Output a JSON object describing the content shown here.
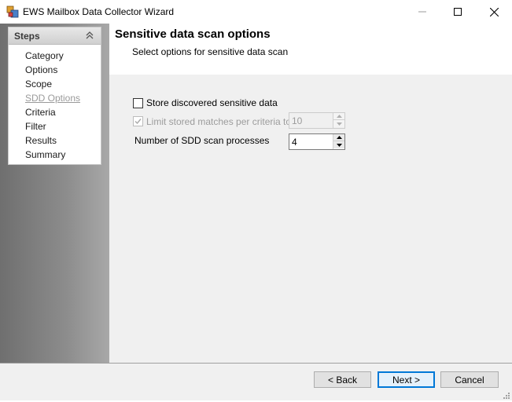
{
  "window": {
    "title": "EWS Mailbox Data Collector Wizard"
  },
  "steps": {
    "title": "Steps",
    "items": [
      {
        "label": "Category"
      },
      {
        "label": "Options"
      },
      {
        "label": "Scope"
      },
      {
        "label": "SDD Options",
        "current": true
      },
      {
        "label": "Criteria"
      },
      {
        "label": "Filter"
      },
      {
        "label": "Results"
      },
      {
        "label": "Summary"
      }
    ]
  },
  "header": {
    "title": "Sensitive data scan options",
    "subtitle": "Select options for sensitive data scan"
  },
  "options": {
    "store_label": "Store discovered sensitive data",
    "store_checked": false,
    "limit_label": "Limit stored matches per criteria to",
    "limit_checked": true,
    "limit_enabled": false,
    "limit_value": "10",
    "processes_label": "Number of SDD scan processes",
    "processes_value": "4"
  },
  "footer": {
    "back_label": "< Back",
    "next_label": "Next >",
    "cancel_label": "Cancel"
  },
  "colors": {
    "accent": "#0078d7",
    "content_bg": "#f0f0f0",
    "disabled_text": "#9c9c9c"
  }
}
